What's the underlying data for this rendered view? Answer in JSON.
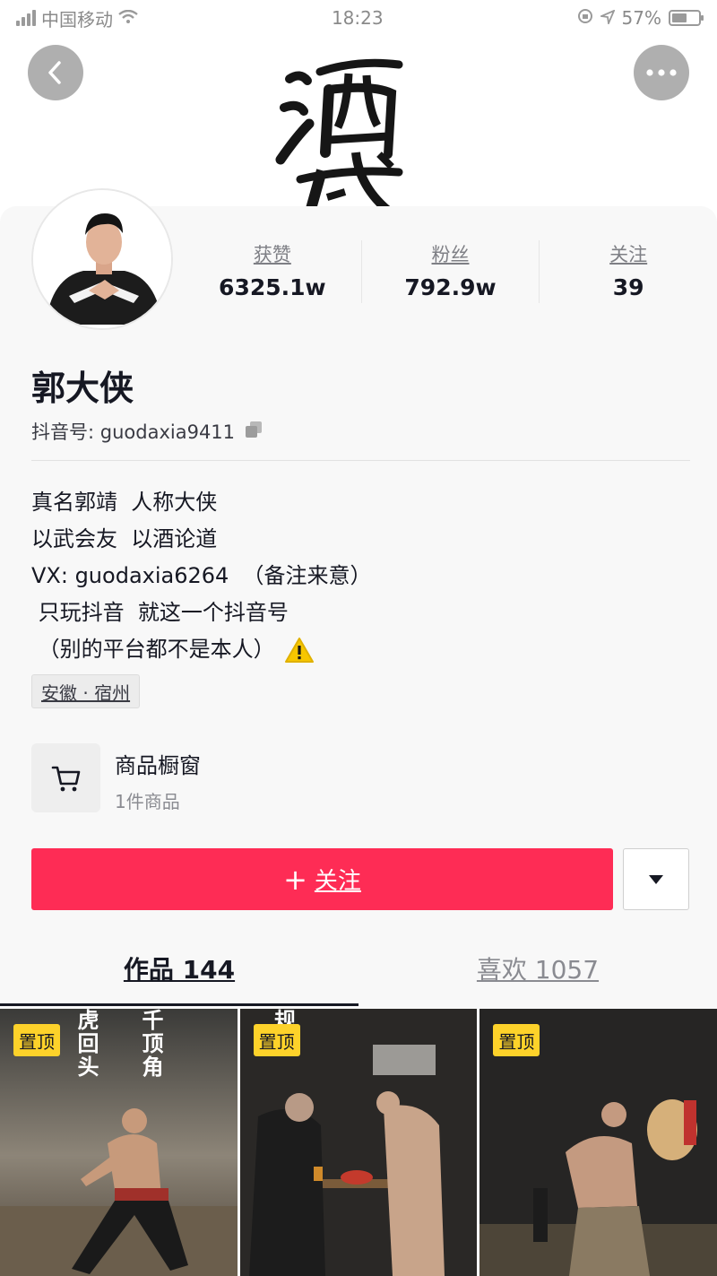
{
  "status_bar": {
    "carrier": "中国移动",
    "time": "18:23",
    "battery": "57%"
  },
  "header": {
    "back_icon": "chevron-left-icon",
    "more_icon": "ellipsis-icon",
    "banner_art": "calligraphy 酒武"
  },
  "profile": {
    "stats": [
      {
        "label": "获赞",
        "value": "6325.1w"
      },
      {
        "label": "粉丝",
        "value": "792.9w"
      },
      {
        "label": "关注",
        "value": "39"
      }
    ],
    "name": "郭大侠",
    "douyin_id_label": "抖音号:",
    "douyin_id": "guodaxia9411",
    "bio": [
      "真名郭靖  人称大侠",
      "以武会友  以酒论道",
      "VX: guodaxia6264  （备注来意）",
      " 只玩抖音  就这一个抖音号",
      " （别的平台都不是本人）"
    ],
    "location": "安徽 · 宿州"
  },
  "shop": {
    "title": "商品橱窗",
    "subtitle": "1件商品"
  },
  "actions": {
    "follow_icon": "+",
    "follow_label": "关注"
  },
  "tabs": [
    {
      "label": "作品 144",
      "active": true
    },
    {
      "label": "喜欢 1057",
      "active": false
    }
  ],
  "videos": [
    {
      "badge": "置顶",
      "overlay_text": [
        "虎回头",
        "千顶角"
      ]
    },
    {
      "badge": "置顶",
      "overlay_text": [
        "规矩"
      ]
    },
    {
      "badge": "置顶",
      "overlay_text": []
    }
  ],
  "colors": {
    "accent": "#fe2c55",
    "pin_badge": "#fdd22a",
    "warning": "#f7c600"
  }
}
